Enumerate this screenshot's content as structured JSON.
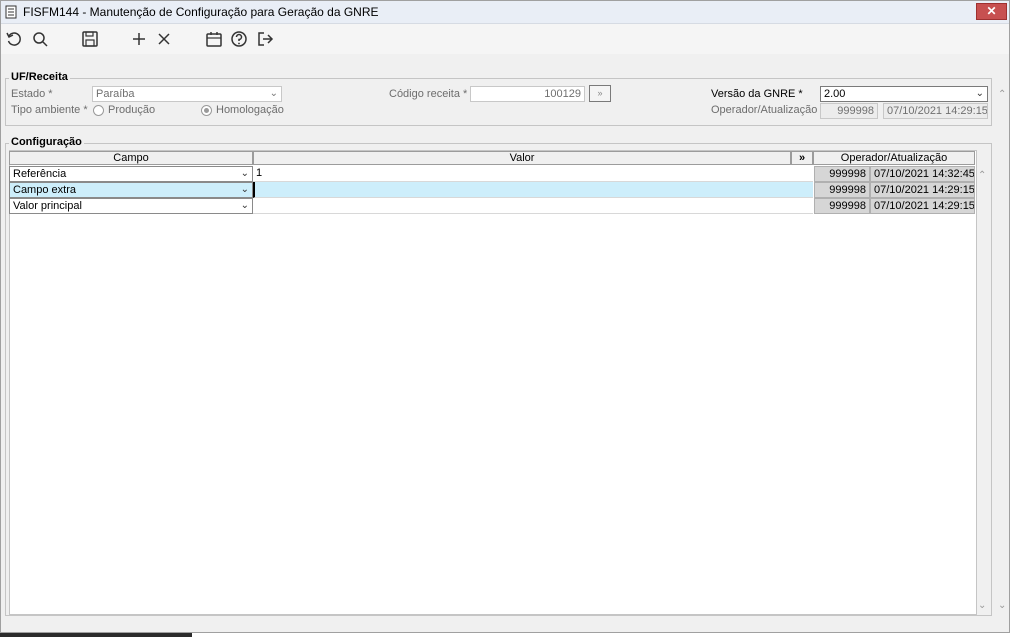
{
  "window": {
    "title": "FISFM144 - Manutenção de Configuração para Geração da GNRE",
    "close_label": "✕"
  },
  "toolbar": {
    "buttons": [
      {
        "name": "refresh-icon"
      },
      {
        "name": "search-icon"
      },
      {
        "name": "save-icon"
      },
      {
        "name": "add-icon"
      },
      {
        "name": "delete-icon"
      },
      {
        "name": "calendar-icon"
      },
      {
        "name": "help-icon"
      },
      {
        "name": "exit-icon"
      }
    ]
  },
  "uf_receita": {
    "group_label": "UF/Receita",
    "estado_label": "Estado *",
    "estado_value": "Paraíba",
    "codigo_label": "Código receita *",
    "codigo_value": "100129",
    "versao_label": "Versão da GNRE *",
    "versao_value": "2.00",
    "tipo_label": "Tipo ambiente *",
    "tipo_options": [
      "Produção",
      "Homologação"
    ],
    "tipo_selected": "Homologação",
    "operador_label": "Operador/Atualização",
    "operador_value": "999998",
    "atualizacao_value": "07/10/2021 14:29:15"
  },
  "configuracao": {
    "group_label": "Configuração",
    "columns": {
      "campo": "Campo",
      "valor": "Valor",
      "expand": "»",
      "operador": "Operador/Atualização"
    },
    "rows": [
      {
        "campo": "Referência",
        "valor": "1",
        "operador": "999998",
        "data": "07/10/2021 14:32:45"
      },
      {
        "campo": "Campo extra",
        "valor": "",
        "operador": "999998",
        "data": "07/10/2021 14:29:15"
      },
      {
        "campo": "Valor principal",
        "valor": "",
        "operador": "999998",
        "data": "07/10/2021 14:29:15"
      }
    ]
  },
  "colors": {
    "selected_row": "#cdeefb",
    "close_button": "#c75050"
  }
}
